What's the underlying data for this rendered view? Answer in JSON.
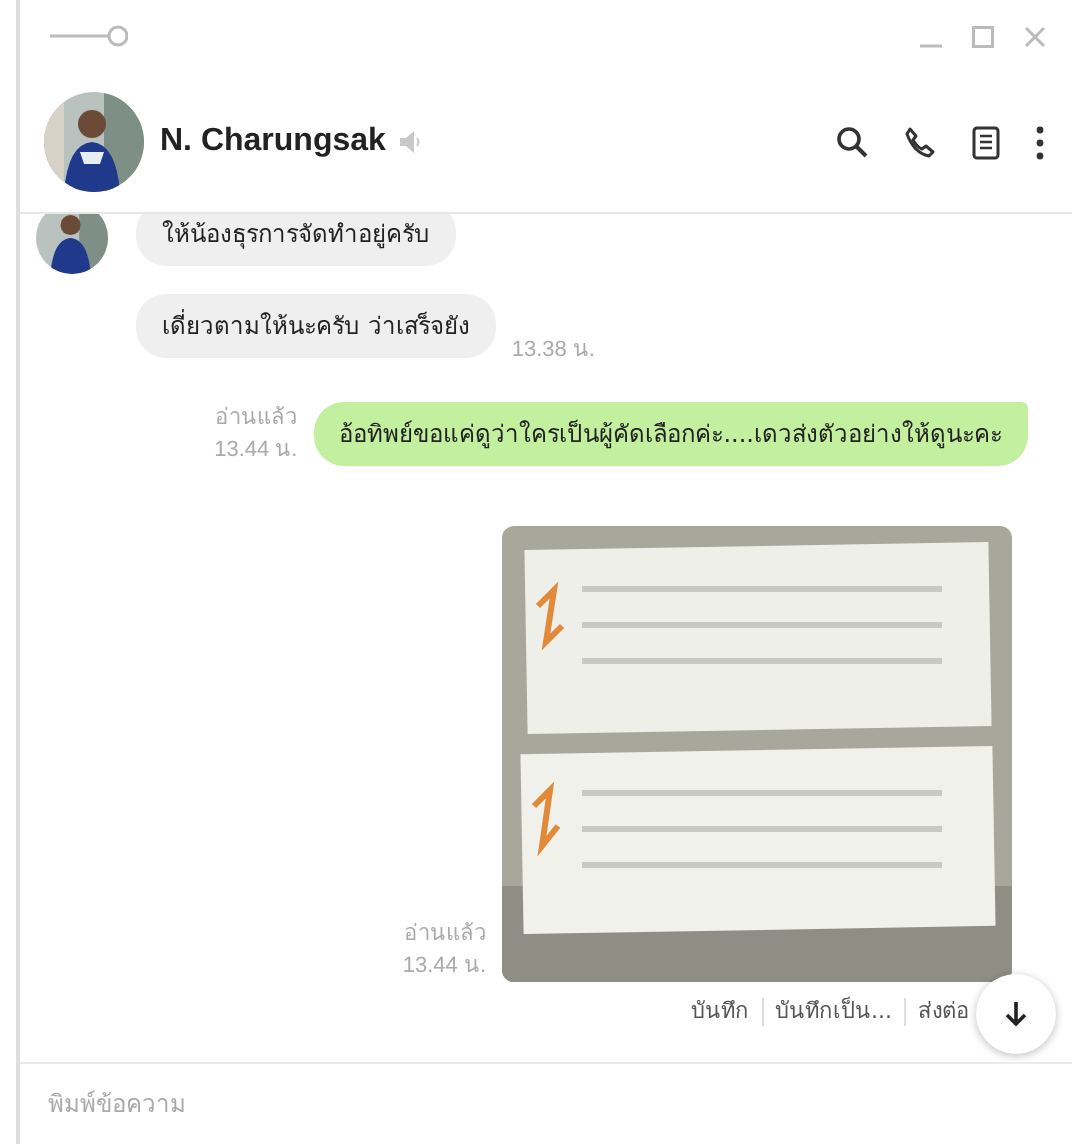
{
  "contact": {
    "name": "N. Charungsak",
    "muted": true
  },
  "messages": [
    {
      "kind": "incoming",
      "show_avatar": true,
      "text": "ให้น้องธุรการจัดทำอยู่ครับ"
    },
    {
      "kind": "incoming",
      "show_avatar": false,
      "text": "เดี่ยวตามให้นะครับ ว่าเสร็จยัง",
      "time": "13.38 น."
    },
    {
      "kind": "outgoing",
      "read": "อ่านแล้ว",
      "time": "13.44 น.",
      "text": "อ้อทิพย์ขอแค่ดูว่าใครเป็นผู้คัดเลือกค่ะ....เดวส่งตัวอย่างให้ดูนะคะ"
    },
    {
      "read": "อ่านแล้ว",
      "time": "13.44 น.",
      "actions": [
        "บันทึก",
        "บันทึกเป็น...",
        "ส่งต่อ"
      ]
    }
  ],
  "composer": {
    "placeholder": "พิมพ์ข้อความ"
  }
}
